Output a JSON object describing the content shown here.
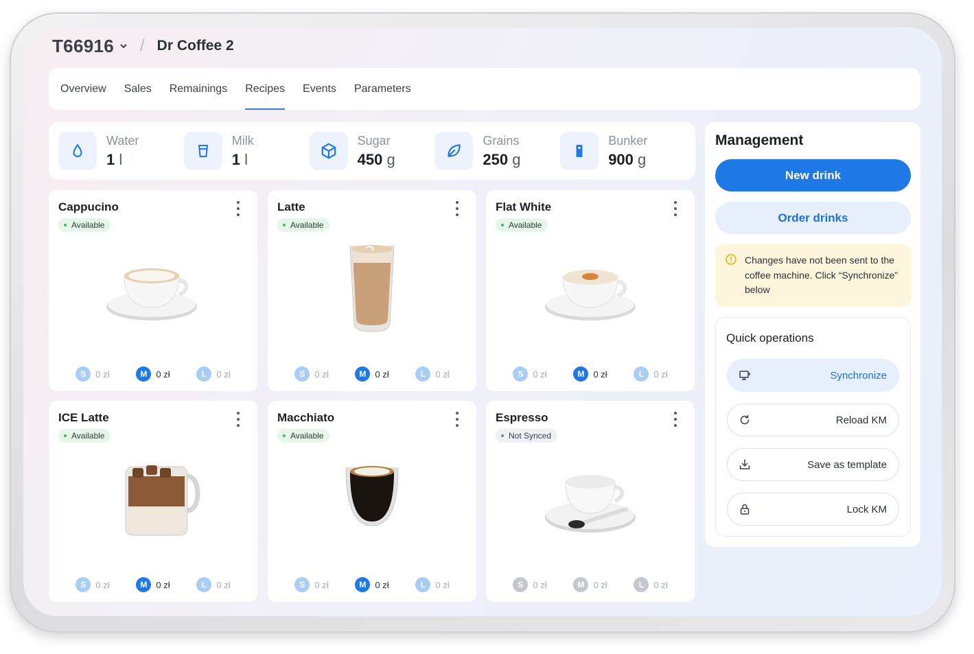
{
  "header": {
    "machine_id": "T66916",
    "separator": "/",
    "machine_name": "Dr Coffee 2"
  },
  "tabs": [
    {
      "label": "Overview"
    },
    {
      "label": "Sales"
    },
    {
      "label": "Remainings"
    },
    {
      "label": "Recipes",
      "active": true
    },
    {
      "label": "Events"
    },
    {
      "label": "Parameters"
    }
  ],
  "stats": [
    {
      "label": "Water",
      "value": "1",
      "unit": "l",
      "icon": "water-drop-icon"
    },
    {
      "label": "Milk",
      "value": "1",
      "unit": "l",
      "icon": "cup-icon"
    },
    {
      "label": "Sugar",
      "value": "450",
      "unit": "g",
      "icon": "cube-icon"
    },
    {
      "label": "Grains",
      "value": "250",
      "unit": "g",
      "icon": "leaf-icon"
    },
    {
      "label": "Bunker",
      "value": "900",
      "unit": "g",
      "icon": "bunker-icon"
    }
  ],
  "drinks": [
    {
      "name": "Cappucino",
      "status": "Available",
      "sizes": [
        {
          "size": "S",
          "price": "0 zł"
        },
        {
          "size": "M",
          "price": "0 zł"
        },
        {
          "size": "L",
          "price": "0 zł"
        }
      ]
    },
    {
      "name": "Latte",
      "status": "Available",
      "sizes": [
        {
          "size": "S",
          "price": "0 zł"
        },
        {
          "size": "M",
          "price": "0 zł"
        },
        {
          "size": "L",
          "price": "0 zł"
        }
      ]
    },
    {
      "name": "Flat White",
      "status": "Available",
      "sizes": [
        {
          "size": "S",
          "price": "0 zł"
        },
        {
          "size": "M",
          "price": "0 zł"
        },
        {
          "size": "L",
          "price": "0 zł"
        }
      ]
    },
    {
      "name": "ICE Latte",
      "status": "Available",
      "sizes": [
        {
          "size": "S",
          "price": "0 zł"
        },
        {
          "size": "M",
          "price": "0 zł"
        },
        {
          "size": "L",
          "price": "0 zł"
        }
      ]
    },
    {
      "name": "Macchiato",
      "status": "Available",
      "sizes": [
        {
          "size": "S",
          "price": "0 zł"
        },
        {
          "size": "M",
          "price": "0 zł"
        },
        {
          "size": "L",
          "price": "0 zł"
        }
      ]
    },
    {
      "name": "Espresso",
      "status": "Not Synced",
      "sizes": [
        {
          "size": "S",
          "price": "0 zł"
        },
        {
          "size": "M",
          "price": "0 zł"
        },
        {
          "size": "L",
          "price": "0 zł"
        }
      ]
    }
  ],
  "management": {
    "title": "Management",
    "new_drink": "New drink",
    "order_drinks": "Order drinks",
    "warning": "Changes have not been sent to the coffee machine. Click “Synchronize” below",
    "quick_title": "Quick operations",
    "quick_ops": [
      {
        "label": "Synchronize",
        "icon": "monitor-sync-icon"
      },
      {
        "label": "Reload KM",
        "icon": "reload-icon"
      },
      {
        "label": "Save as template",
        "icon": "download-icon"
      },
      {
        "label": "Lock KM",
        "icon": "lock-icon"
      }
    ]
  },
  "colors": {
    "accent": "#1e78e6",
    "available": "#3eba6a",
    "warning_bg": "#fdf6dc"
  }
}
